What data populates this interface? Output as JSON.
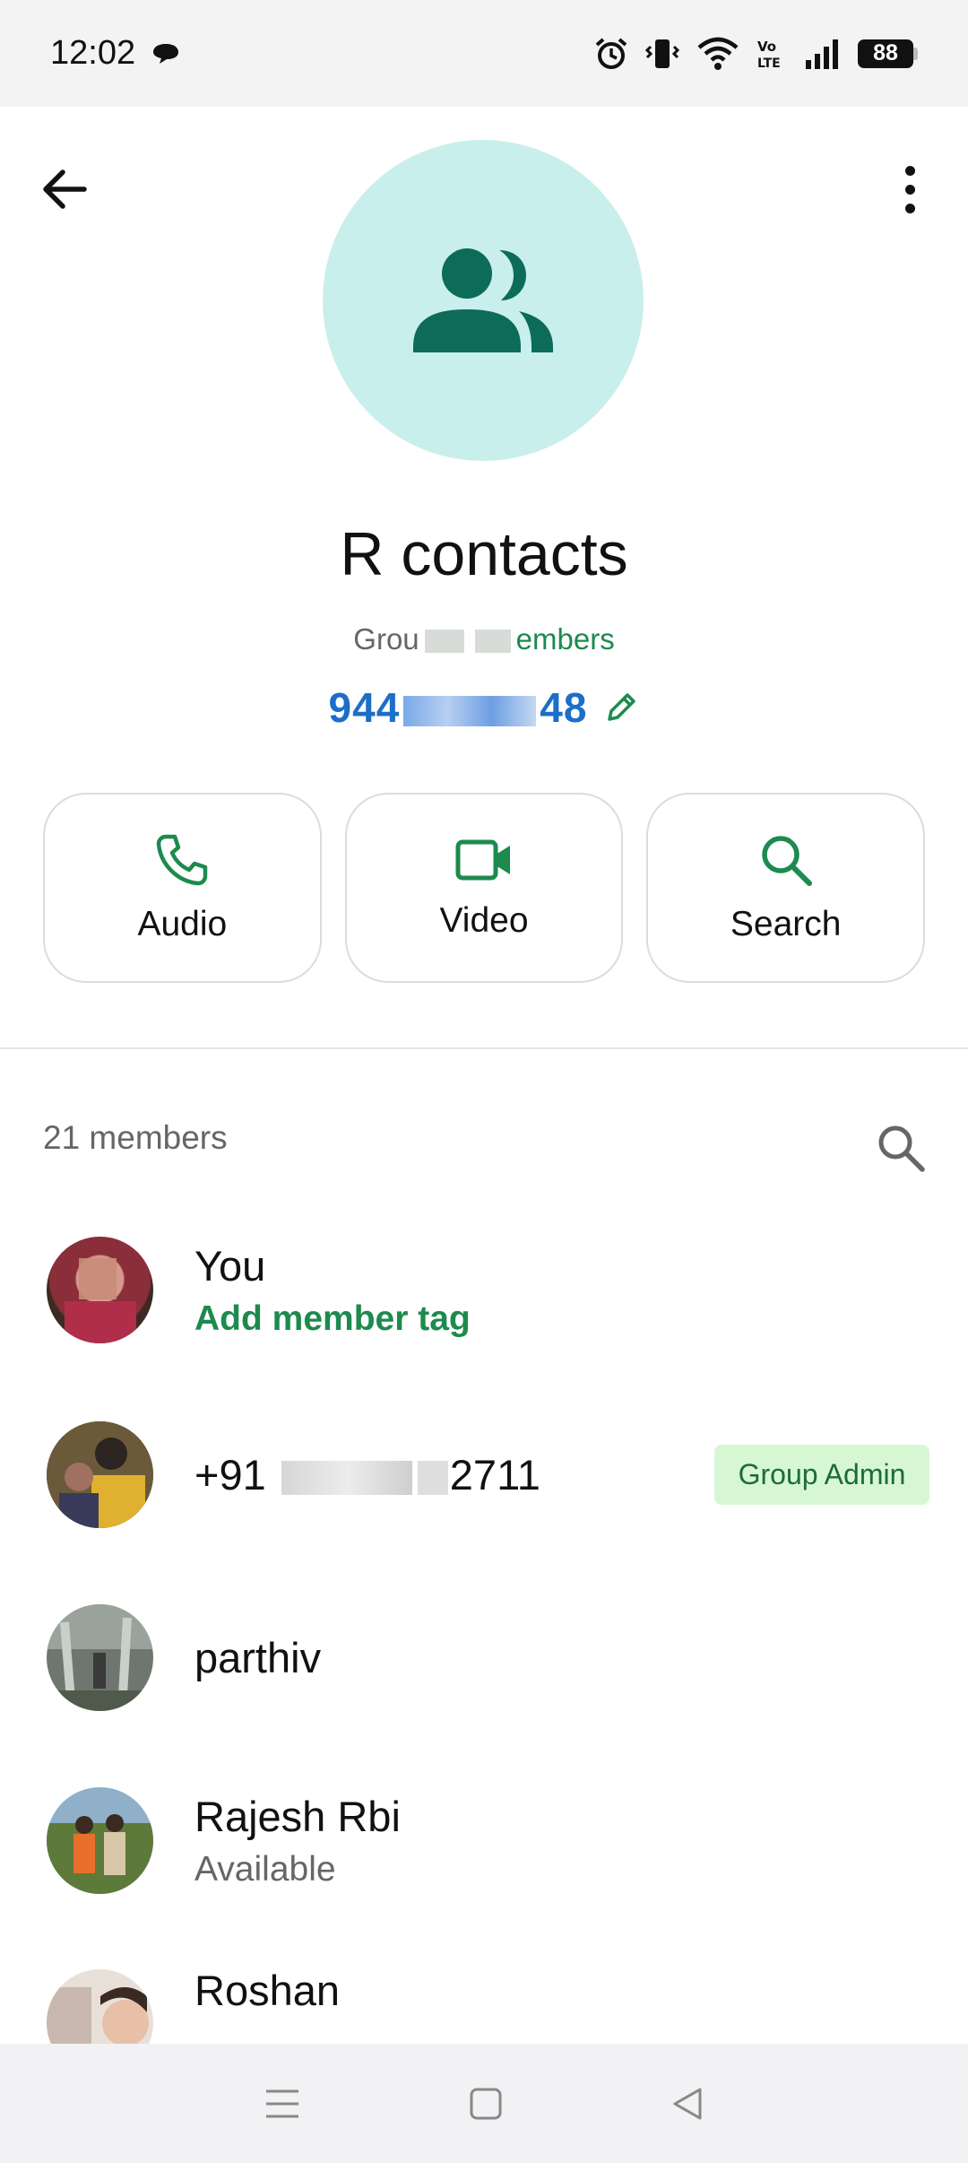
{
  "status_bar": {
    "time": "12:02",
    "battery": "88",
    "icons": [
      "chat-bubble-icon",
      "alarm-icon",
      "vibrate-icon",
      "wifi-icon",
      "volte-icon",
      "signal-icon",
      "battery-icon"
    ]
  },
  "header": {
    "back_icon": "arrow-back-icon",
    "menu_icon": "more-vertical-icon",
    "avatar_icon": "group-icon",
    "group_name": "R contacts",
    "group_sub_prefix": "Grou",
    "group_sub_suffix": "embers",
    "group_code_prefix": "944",
    "group_code_suffix": "48",
    "edit_icon": "pencil-icon"
  },
  "actions": [
    {
      "label": "Audio",
      "icon": "phone-icon"
    },
    {
      "label": "Video",
      "icon": "video-camera-icon"
    },
    {
      "label": "Search",
      "icon": "search-icon"
    }
  ],
  "members": {
    "heading": "21 members",
    "search_icon": "search-icon",
    "list": [
      {
        "name": "You",
        "sub": "Add member tag"
      },
      {
        "name_prefix": "+91",
        "name_suffix": "2711",
        "badge": "Group Admin"
      },
      {
        "name": "parthiv"
      },
      {
        "name": "Rajesh Rbi",
        "sub": "Available"
      },
      {
        "name": "Roshan"
      }
    ]
  },
  "nav_bar": {
    "icons": [
      "menu-lines-icon",
      "home-square-icon",
      "back-triangle-icon"
    ]
  },
  "colors": {
    "accent_green": "#1d8a4e",
    "avatar_bg": "#c9efec",
    "avatar_icon": "#0d6b5a",
    "link_blue": "#1b6fc8",
    "admin_badge_bg": "#d7f7d4"
  }
}
